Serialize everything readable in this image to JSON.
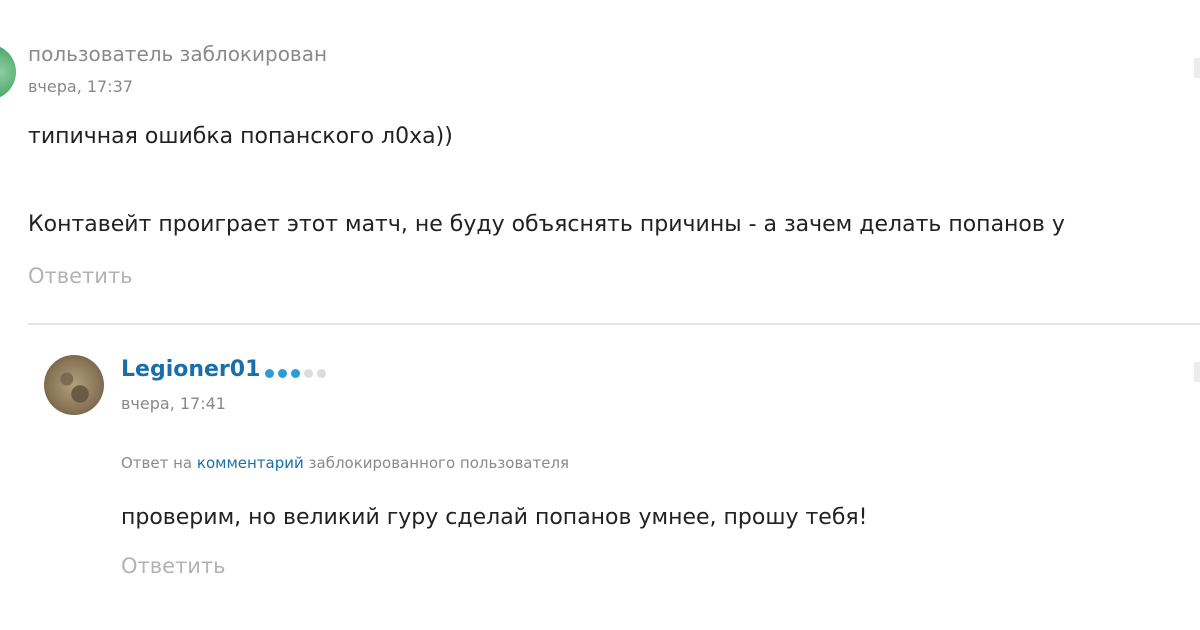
{
  "comment1": {
    "author": "пользователь заблокирован",
    "time": "вчера, 17:37",
    "text_line1": "типичная ошибка попанского л0ха))",
    "text_line2": "Контавейт проиграет этот матч, не буду объяснять причины - а зачем делать попанов у",
    "reply_label": "Ответить"
  },
  "comment2": {
    "author": "Legioner01",
    "rank_dots": {
      "filled": 3,
      "total": 5
    },
    "time": "вчера, 17:41",
    "reply_to": {
      "prefix": "Ответ на",
      "link": "комментарий",
      "suffix": "заблокированного пользователя"
    },
    "text": "проверим, но великий гуру сделай попанов умнее, прошу тебя!",
    "reply_label": "Ответить"
  },
  "colors": {
    "link": "#1a6fa8",
    "rank_on": "#2e9ad6",
    "rank_off": "#dcdcdc",
    "muted": "#8a8a8a"
  }
}
